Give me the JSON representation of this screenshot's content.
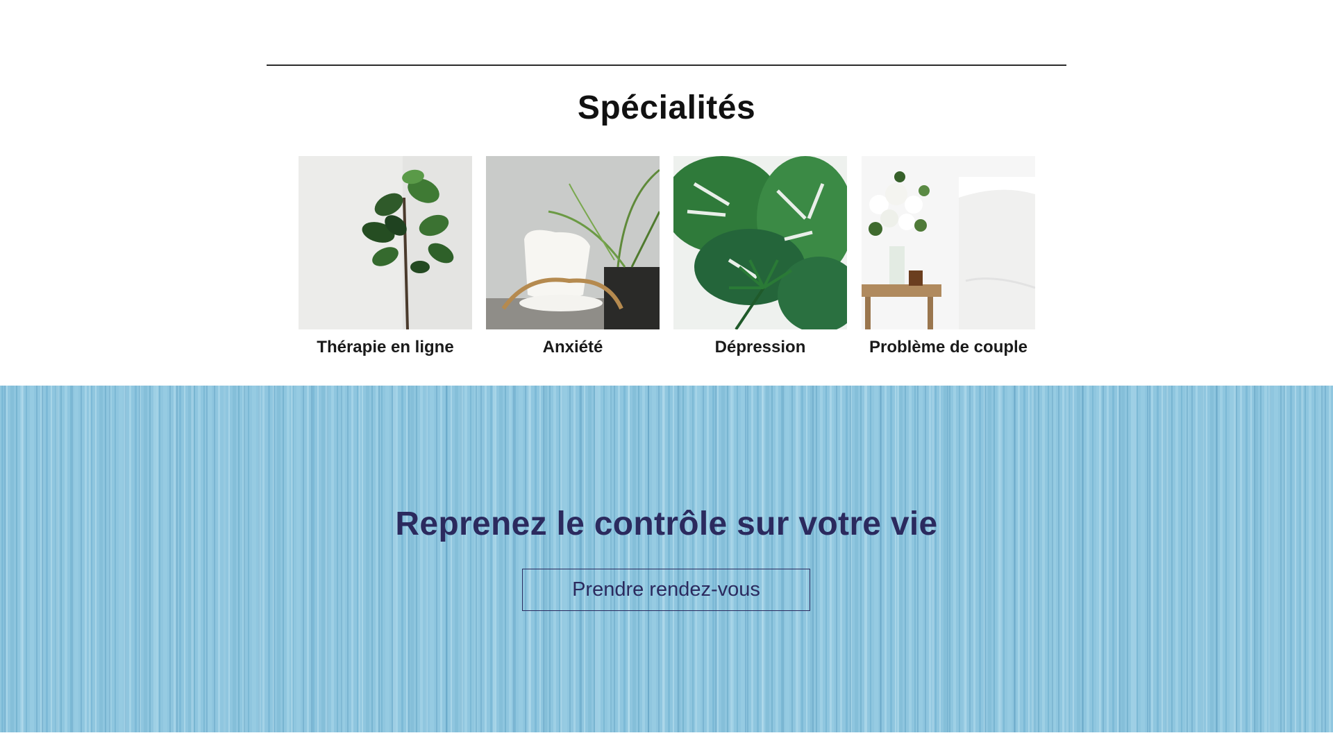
{
  "specialties": {
    "title": "Spécialités",
    "items": [
      {
        "label": "Thérapie en ligne",
        "image": "fiddle-leaf-plant-image"
      },
      {
        "label": "Anxiété",
        "image": "white-chair-palm-image"
      },
      {
        "label": "Dépression",
        "image": "monstera-leaves-image"
      },
      {
        "label": "Problème de couple",
        "image": "flowers-bedside-image"
      }
    ]
  },
  "banner": {
    "title": "Reprenez le contrôle sur votre vie",
    "cta_label": "Prendre rendez-vous",
    "background": "blue-water-texture"
  },
  "colors": {
    "heading": "#111111",
    "banner_bg": "#8fc6df",
    "banner_text": "#2b2a5e"
  }
}
